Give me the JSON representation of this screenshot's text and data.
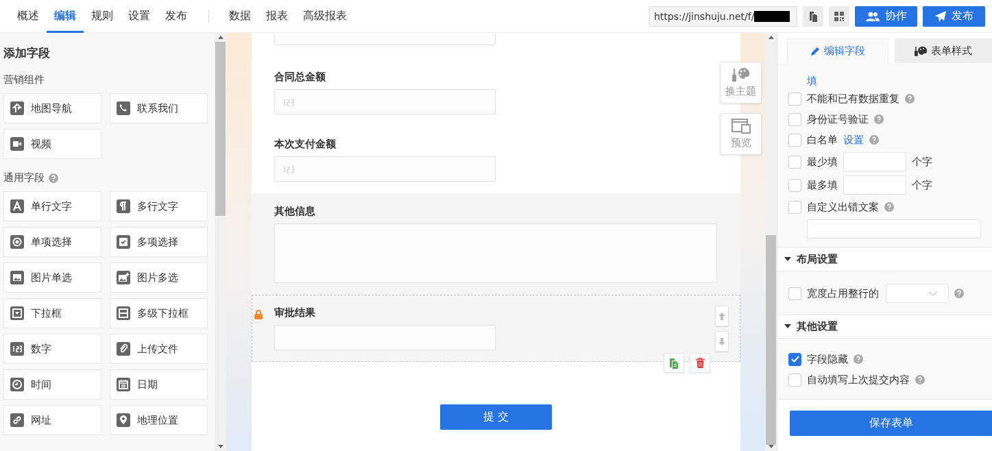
{
  "nav": {
    "tabs": [
      {
        "label": "概述",
        "selected": false
      },
      {
        "label": "编辑",
        "selected": true
      },
      {
        "label": "规则",
        "selected": false
      },
      {
        "label": "设置",
        "selected": false
      },
      {
        "label": "发布",
        "selected": false
      }
    ],
    "report_tabs": [
      {
        "label": "数据",
        "selected": false
      },
      {
        "label": "报表",
        "selected": false
      },
      {
        "label": "高级报表",
        "selected": false
      }
    ],
    "url": "https://jinshuju.net/f/",
    "actions": [
      {
        "kind": "collab",
        "label": "协作"
      },
      {
        "kind": "publish",
        "label": "发布"
      }
    ]
  },
  "sidebar": {
    "title": "添加字段",
    "groups": [
      {
        "title": "营销组件",
        "help": false,
        "items": [
          {
            "kind": "map",
            "label": "地图导航"
          },
          {
            "kind": "contact",
            "label": "联系我们"
          },
          {
            "kind": "video",
            "label": "视频"
          }
        ]
      },
      {
        "title": "通用字段",
        "help": true,
        "items": [
          {
            "kind": "text",
            "label": "单行文字"
          },
          {
            "kind": "paragraph",
            "label": "多行文字"
          },
          {
            "kind": "radio",
            "label": "单项选择"
          },
          {
            "kind": "checkbox",
            "label": "多项选择"
          },
          {
            "kind": "image",
            "label": "图片单选"
          },
          {
            "kind": "images",
            "label": "图片多选"
          },
          {
            "kind": "dropdown",
            "label": "下拉框"
          },
          {
            "kind": "cascade",
            "label": "多级下拉框"
          },
          {
            "kind": "number",
            "label": "数字"
          },
          {
            "kind": "upload",
            "label": "上传文件"
          },
          {
            "kind": "time",
            "label": "时间"
          },
          {
            "kind": "date",
            "label": "日期"
          },
          {
            "kind": "link",
            "label": "网址"
          },
          {
            "kind": "location",
            "label": "地理位置"
          }
        ]
      }
    ]
  },
  "canvas": {
    "tools": [
      {
        "kind": "theme",
        "label": "换主题"
      },
      {
        "kind": "preview",
        "label": "预览"
      }
    ],
    "fields": [
      {
        "kind": "clipped"
      },
      {
        "kind": "number",
        "label": "合同总金额",
        "shaded": false,
        "selected": false,
        "locked": false
      },
      {
        "kind": "number",
        "label": "本次支付金额",
        "shaded": false,
        "selected": false,
        "locked": false
      },
      {
        "kind": "textarea",
        "label": "其他信息",
        "shaded": true,
        "selected": false,
        "locked": false
      },
      {
        "kind": "text",
        "label": "审批结果",
        "shaded": true,
        "selected": true,
        "locked": true
      }
    ],
    "submit": "提 交"
  },
  "panel": {
    "tabs": [
      {
        "kind": "edit",
        "label": "编辑字段",
        "selected": true
      },
      {
        "kind": "style",
        "label": "表单样式",
        "selected": false
      }
    ],
    "clipped_link": "填",
    "options": [
      {
        "kind": "check",
        "label": "不能和已有数据重复",
        "checked": false,
        "help": true
      },
      {
        "kind": "check",
        "label": "身份证号验证",
        "checked": false,
        "help": true
      },
      {
        "kind": "link",
        "label": "白名单",
        "link": "设置",
        "checked": false,
        "help": true
      },
      {
        "kind": "input",
        "label": "最少填",
        "suffix": "个字",
        "checked": false,
        "help": false
      },
      {
        "kind": "input",
        "label": "最多填",
        "suffix": "个字",
        "checked": false,
        "help": false
      },
      {
        "kind": "textarea",
        "label": "自定义出错文案",
        "checked": false,
        "help": true
      }
    ],
    "sections": [
      {
        "title": "布局设置",
        "expanded": true,
        "options": [
          {
            "kind": "select",
            "label": "宽度占用整行的",
            "checked": false,
            "help": true
          }
        ]
      },
      {
        "title": "其他设置",
        "expanded": true,
        "options": [
          {
            "kind": "check",
            "label": "字段隐藏",
            "checked": true,
            "help": true
          },
          {
            "kind": "check",
            "label": "自动填写上次提交内容",
            "checked": false,
            "help": true
          }
        ]
      }
    ],
    "save": "保存表单"
  }
}
